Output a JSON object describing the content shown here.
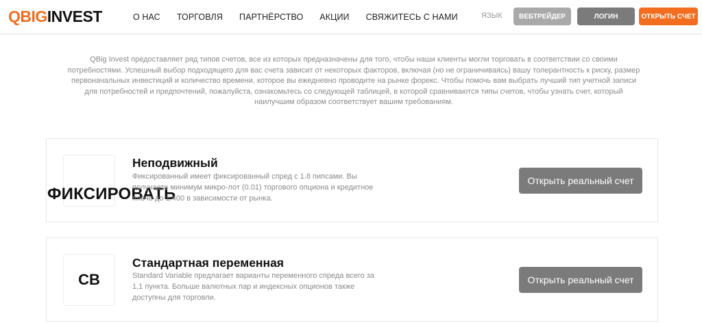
{
  "header": {
    "logo": {
      "part1": "QBIG",
      "part2": "INVEST"
    },
    "nav": [
      "О НАС",
      "ТОРГОВЛЯ",
      "ПАРТНЁРСТВО",
      "АКЦИИ",
      "СВЯЖИТЕСЬ С НАМИ"
    ],
    "language_label": "ЯЗЫК",
    "webtrader_label": "ВЕБТРЕЙДЕР",
    "login_label": "ЛОГИН",
    "open_account_label": "ОТКРЫТЬ СЧЕТ"
  },
  "intro": "QBig Invest предоставляет ряд типов счетов, все из которых предназначены для того, чтобы наши клиенты могли торговать в соответствии со своими потребностями. Успешный выбор подходящего для вас счета зависит от некоторых факторов, включая (но не ограничиваясь) вашу толерантность к риску, размер первоначальных инвестиций и количество времени, которое вы ежедневно проводите на рынке форекс. Чтобы помочь вам выбрать лучший тип учетной записи для потребностей и предпочтений, пожалуйста, ознакомьтесь со следующей таблицей, в которой сравниваются типы счетов, чтобы узнать счет, который наилучшим образом соответствует вашим требованиям.",
  "accounts": [
    {
      "icon_text": "ФИКСИРОВАТЬ",
      "title": "Неподвижный",
      "description": "Фиксированный имеет фиксированный спред с 1.8 пипсами. Вы получаете минимум микро-лот (0.01) торгового опциона и кредитное плечо до 1:400 в зависимости от рынка.",
      "button_label": "Открыть реальный счет"
    },
    {
      "icon_text": "СВ",
      "title": "Стандартная переменная",
      "description": "Standard Variable предлагает варианты переменного спреда всего за 1,1 пункта. Больше валютных пар и индексных опционов также доступны для торговли.",
      "button_label": "Открыть реальный счет"
    }
  ],
  "colors": {
    "brand_orange": "#f36d21",
    "button_gray": "#7b7b7b",
    "button_light_gray": "#a9a9a9",
    "muted_text": "#8a8a8a"
  }
}
